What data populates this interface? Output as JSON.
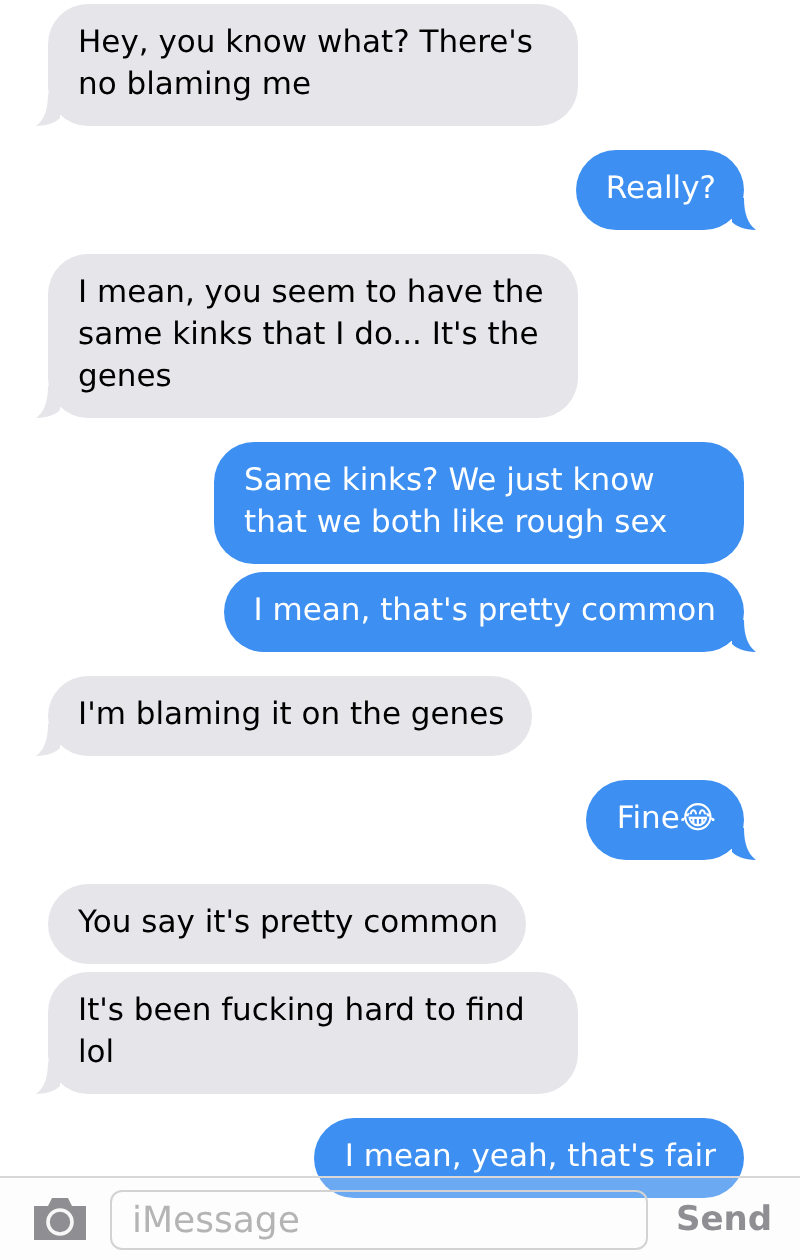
{
  "messages": [
    {
      "kind": "received",
      "text": "Hey, you know what? There's no blaming me",
      "tail": true
    },
    {
      "kind": "sent",
      "text": "Really?",
      "tail": true
    },
    {
      "kind": "received",
      "text": "I mean, you seem to have the same kinks that I do... It's the genes",
      "tail": true
    },
    {
      "kind": "sent",
      "text": "Same kinks? We just know that we both like rough sex",
      "tail": false
    },
    {
      "kind": "sent",
      "text": "I mean, that's pretty common",
      "tail": true
    },
    {
      "kind": "received",
      "text": "I'm blaming it on the genes",
      "tail": true
    },
    {
      "kind": "sent",
      "text": "Fine😂",
      "tail": true
    },
    {
      "kind": "received",
      "text": "You say it's pretty common",
      "tail": false
    },
    {
      "kind": "received",
      "text": "It's been fucking hard to find lol",
      "tail": true
    },
    {
      "kind": "sent",
      "text": "I mean, yeah, that's fair",
      "tail": false
    }
  ],
  "composer": {
    "placeholder": "iMessage",
    "send": "Send"
  }
}
